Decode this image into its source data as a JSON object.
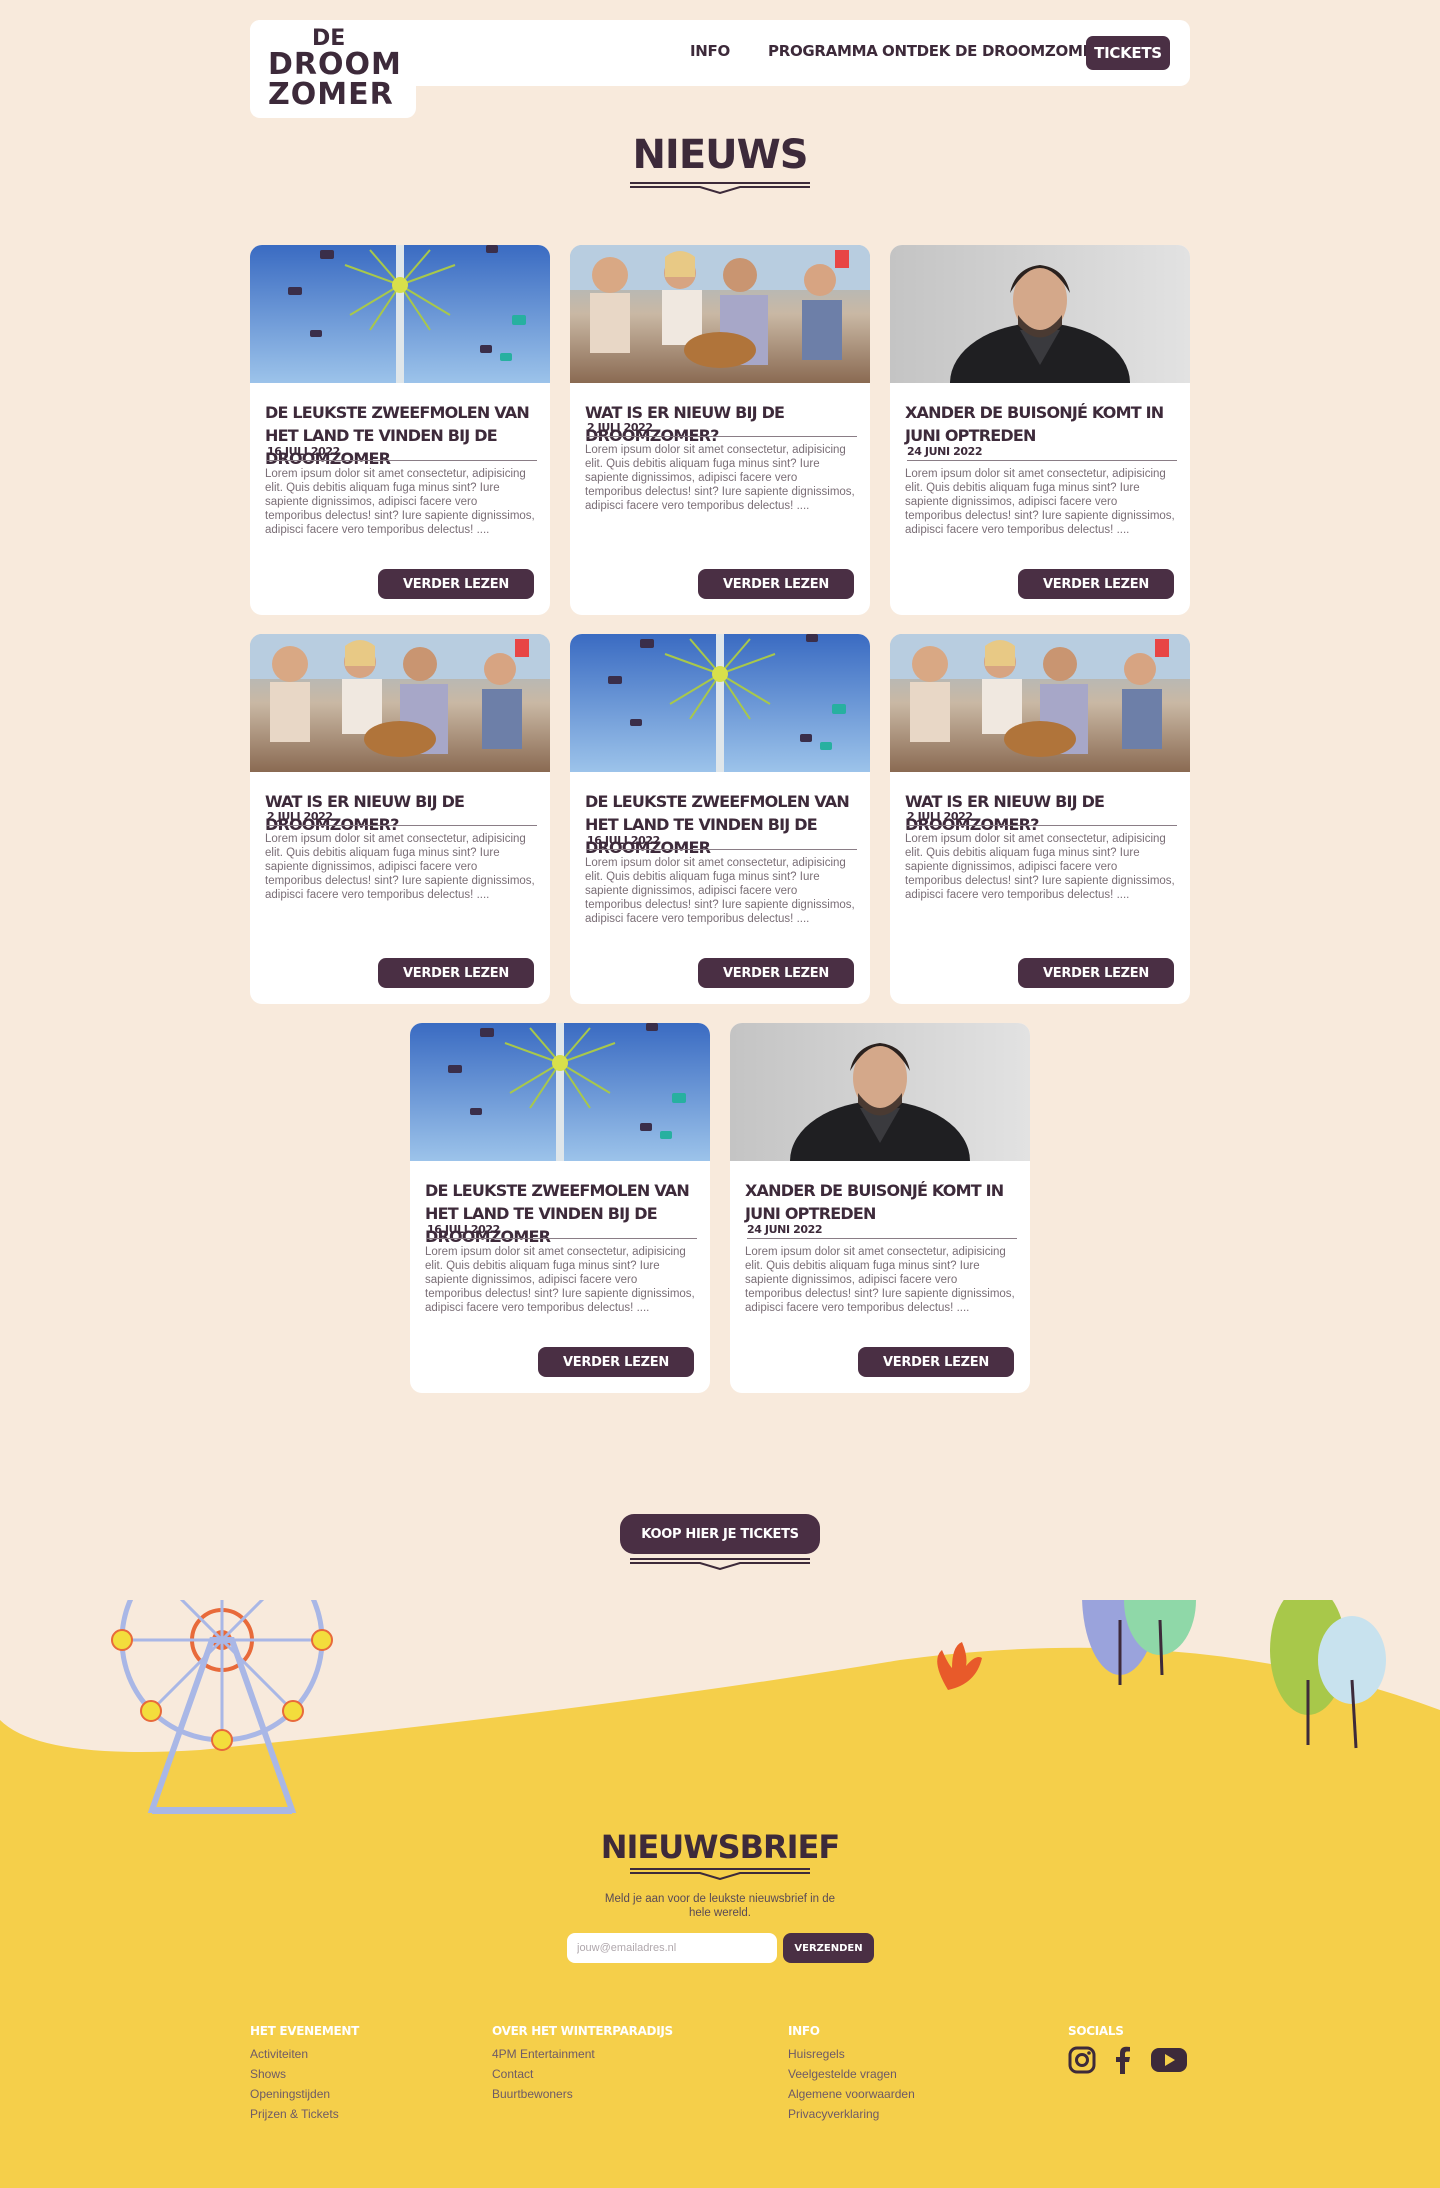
{
  "header": {
    "logo": {
      "line1": "DE",
      "line2": "DROOM",
      "line3": "ZOMER"
    },
    "nav": {
      "info": "INFO",
      "programma": "PROGRAMMA",
      "ontdek": "ONTDEK DE DROOMZOMER",
      "tickets": "TICKETS"
    }
  },
  "page_title": "NIEUWS",
  "cards": [
    {
      "image": "swing-ride",
      "title": "DE LEUKSTE ZWEEFMOLEN VAN HET LAND TE VINDEN BIJ DE DROOMZOMER",
      "date": "16 JULI 2022",
      "text": "Lorem ipsum dolor sit amet consectetur, adipisicing elit. Quis debitis aliquam fuga minus sint? Iure sapiente dignissimos, adipisci facere vero temporibus delectus!  sint? Iure sapiente dignissimos, adipisci facere vero temporibus delectus! ....",
      "button": "VERDER LEZEN"
    },
    {
      "image": "friends-guitar",
      "title": "WAT IS ER NIEUW BIJ DE DROOMZOMER?",
      "date": "2 JULI 2022",
      "text": "Lorem ipsum dolor sit amet consectetur, adipisicing elit. Quis debitis aliquam fuga minus sint? Iure sapiente dignissimos, adipisci facere vero temporibus delectus!  sint? Iure sapiente dignissimos, adipisci facere vero temporibus delectus! ....",
      "button": "VERDER LEZEN"
    },
    {
      "image": "portrait",
      "title": "XANDER DE BUISONJÉ KOMT IN JUNI OPTREDEN",
      "date": "24 JUNI 2022",
      "text": "Lorem ipsum dolor sit amet consectetur, adipisicing elit. Quis debitis aliquam fuga minus sint? Iure sapiente dignissimos, adipisci facere vero temporibus delectus!  sint? Iure sapiente dignissimos, adipisci facere vero temporibus delectus! ....",
      "button": "VERDER LEZEN"
    },
    {
      "image": "friends-guitar",
      "title": "WAT IS ER NIEUW BIJ DE DROOMZOMER?",
      "date": "2 JULI 2022",
      "text": "Lorem ipsum dolor sit amet consectetur, adipisicing elit. Quis debitis aliquam fuga minus sint? Iure sapiente dignissimos, adipisci facere vero temporibus delectus!  sint? Iure sapiente dignissimos, adipisci facere vero temporibus delectus! ....",
      "button": "VERDER LEZEN"
    },
    {
      "image": "swing-ride",
      "title": "DE LEUKSTE ZWEEFMOLEN VAN HET LAND TE VINDEN BIJ DE DROOMZOMER",
      "date": "16 JULI 2022",
      "text": "Lorem ipsum dolor sit amet consectetur, adipisicing elit. Quis debitis aliquam fuga minus sint? Iure sapiente dignissimos, adipisci facere vero temporibus delectus!  sint? Iure sapiente dignissimos, adipisci facere vero temporibus delectus! ....",
      "button": "VERDER LEZEN"
    },
    {
      "image": "friends-guitar",
      "title": "WAT IS ER NIEUW BIJ DE DROOMZOMER?",
      "date": "2 JULI 2022",
      "text": "Lorem ipsum dolor sit amet consectetur, adipisicing elit. Quis debitis aliquam fuga minus sint? Iure sapiente dignissimos, adipisci facere vero temporibus delectus!  sint? Iure sapiente dignissimos, adipisci facere vero temporibus delectus! ....",
      "button": "VERDER LEZEN"
    },
    {
      "image": "swing-ride",
      "title": "DE LEUKSTE ZWEEFMOLEN VAN HET LAND TE VINDEN BIJ DE DROOMZOMER",
      "date": "16 JULI 2022",
      "text": "Lorem ipsum dolor sit amet consectetur, adipisicing elit. Quis debitis aliquam fuga minus sint? Iure sapiente dignissimos, adipisci facere vero temporibus delectus!  sint? Iure sapiente dignissimos, adipisci facere vero temporibus delectus! ....",
      "button": "VERDER LEZEN"
    },
    {
      "image": "portrait",
      "title": "XANDER DE BUISONJÉ KOMT IN JUNI OPTREDEN",
      "date": "24 JUNI 2022",
      "text": "Lorem ipsum dolor sit amet consectetur, adipisicing elit. Quis debitis aliquam fuga minus sint? Iure sapiente dignissimos, adipisci facere vero temporibus delectus!  sint? Iure sapiente dignissimos, adipisci facere vero temporibus delectus! ....",
      "button": "VERDER LEZEN"
    }
  ],
  "cta": {
    "label": "KOOP HIER JE TICKETS"
  },
  "newsletter": {
    "title": "NIEUWSBRIEF",
    "description": "Meld je aan voor de leukste nieuwsbrief in de hele wereld.",
    "placeholder": "jouw@emailadres.nl",
    "button": "VERZENDEN"
  },
  "footer": {
    "evenement": {
      "heading": "HET EVENEMENT",
      "links": [
        "Activiteiten",
        "Shows",
        "Openingstijden",
        "Prijzen & Tickets"
      ]
    },
    "winterparadijs": {
      "heading": "OVER HET WINTERPARADIJS",
      "links": [
        "4PM Entertainment",
        "Contact",
        "Buurtbewoners"
      ]
    },
    "info": {
      "heading": "INFO",
      "links": [
        "Huisregels",
        "Veelgestelde vragen",
        "Algemene voorwaarden",
        "Privacyverklaring"
      ]
    },
    "socials": {
      "heading": "SOCIALS",
      "icons": [
        "instagram-icon",
        "facebook-icon",
        "youtube-icon"
      ]
    }
  },
  "colors": {
    "background": "#f8eadc",
    "brand": "#4a2f44",
    "footer": "#f5cf4a"
  }
}
